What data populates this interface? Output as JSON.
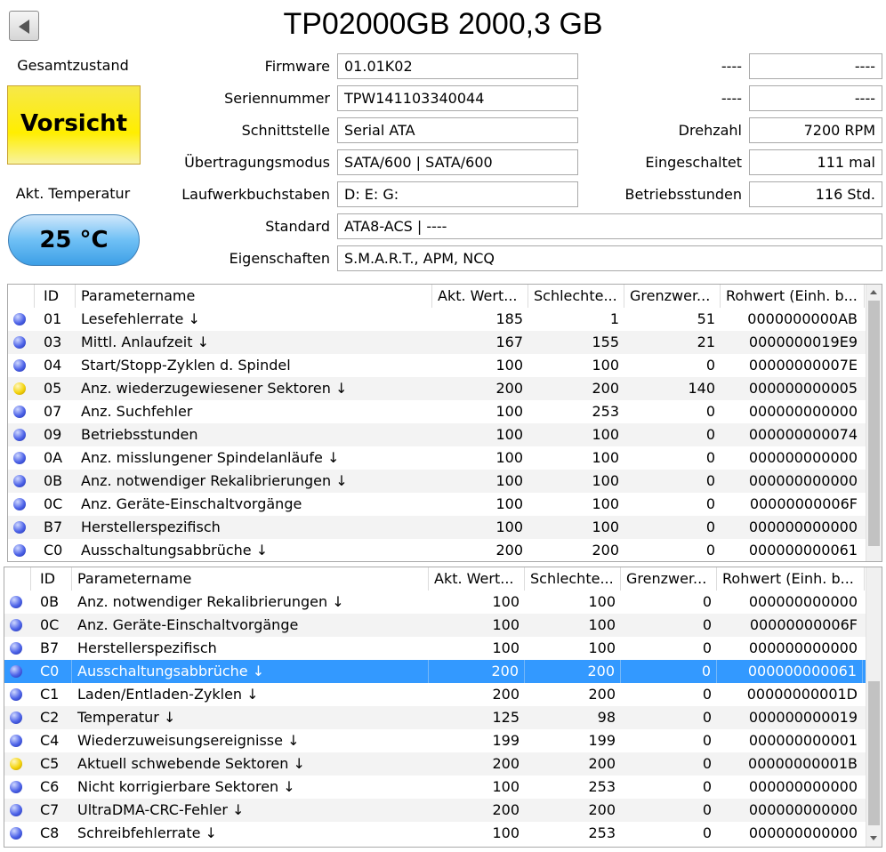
{
  "title": "TP02000GB 2000,3 GB",
  "icons": {
    "back": "back-arrow-icon",
    "status_good": "blue-status-dot-icon",
    "status_caution": "yellow-status-dot-icon"
  },
  "colors": {
    "caution": "#ffee00",
    "temperature": "#4aa8ee",
    "selection": "#3399ff"
  },
  "health": {
    "label": "Gesamtzustand",
    "value": "Vorsicht"
  },
  "temperature": {
    "label": "Akt. Temperatur",
    "value": "25 °C"
  },
  "info": {
    "firmware": {
      "label": "Firmware",
      "value": "01.01K02"
    },
    "serial": {
      "label": "Seriennummer",
      "value": "TPW141103340044"
    },
    "interface": {
      "label": "Schnittstelle",
      "value": "Serial ATA"
    },
    "transfer": {
      "label": "Übertragungsmodus",
      "value": "SATA/600 | SATA/600"
    },
    "drive_letters": {
      "label": "Laufwerkbuchstaben",
      "value": "D: E: G:"
    },
    "standard": {
      "label": "Standard",
      "value": "ATA8-ACS | ----"
    },
    "features": {
      "label": "Eigenschaften",
      "value": "S.M.A.R.T., APM, NCQ"
    }
  },
  "right_info": {
    "r1": {
      "label": "----",
      "value": "----"
    },
    "r2": {
      "label": "----",
      "value": "----"
    },
    "rpm": {
      "label": "Drehzahl",
      "value": "7200 RPM"
    },
    "power_count": {
      "label": "Eingeschaltet",
      "value": "111 mal"
    },
    "power_hours": {
      "label": "Betriebsstunden",
      "value": "116 Std."
    }
  },
  "columns": [
    "ID",
    "Parametername",
    "Akt. Wert...",
    "Schlechte...",
    "Grenzwer...",
    "Rohwert (Einh. b..."
  ],
  "table1_rows": [
    {
      "status": "blue",
      "id": "01",
      "name": "Lesefehlerrate ↓",
      "cur": "185",
      "worst": "1",
      "thr": "51",
      "raw": "0000000000AB"
    },
    {
      "status": "blue",
      "id": "03",
      "name": "Mittl. Anlaufzeit ↓",
      "cur": "167",
      "worst": "155",
      "thr": "21",
      "raw": "0000000019E9"
    },
    {
      "status": "blue",
      "id": "04",
      "name": "Start/Stopp-Zyklen d. Spindel",
      "cur": "100",
      "worst": "100",
      "thr": "0",
      "raw": "00000000007E"
    },
    {
      "status": "yellow",
      "id": "05",
      "name": "Anz. wiederzugewiesener Sektoren ↓",
      "cur": "200",
      "worst": "200",
      "thr": "140",
      "raw": "000000000005"
    },
    {
      "status": "blue",
      "id": "07",
      "name": "Anz. Suchfehler",
      "cur": "100",
      "worst": "253",
      "thr": "0",
      "raw": "000000000000"
    },
    {
      "status": "blue",
      "id": "09",
      "name": "Betriebsstunden",
      "cur": "100",
      "worst": "100",
      "thr": "0",
      "raw": "000000000074"
    },
    {
      "status": "blue",
      "id": "0A",
      "name": "Anz. misslungener Spindelanläufe ↓",
      "cur": "100",
      "worst": "100",
      "thr": "0",
      "raw": "000000000000"
    },
    {
      "status": "blue",
      "id": "0B",
      "name": "Anz. notwendiger Rekalibrierungen ↓",
      "cur": "100",
      "worst": "100",
      "thr": "0",
      "raw": "000000000000"
    },
    {
      "status": "blue",
      "id": "0C",
      "name": "Anz. Geräte-Einschaltvorgänge",
      "cur": "100",
      "worst": "100",
      "thr": "0",
      "raw": "00000000006F"
    },
    {
      "status": "blue",
      "id": "B7",
      "name": "Herstellerspezifisch",
      "cur": "100",
      "worst": "100",
      "thr": "0",
      "raw": "000000000000"
    },
    {
      "status": "blue",
      "id": "C0",
      "name": "Ausschaltungsabbrüche ↓",
      "cur": "200",
      "worst": "200",
      "thr": "0",
      "raw": "000000000061"
    }
  ],
  "table2_rows": [
    {
      "status": "blue",
      "id": "0B",
      "name": "Anz. notwendiger Rekalibrierungen ↓",
      "cur": "100",
      "worst": "100",
      "thr": "0",
      "raw": "000000000000"
    },
    {
      "status": "blue",
      "id": "0C",
      "name": "Anz. Geräte-Einschaltvorgänge",
      "cur": "100",
      "worst": "100",
      "thr": "0",
      "raw": "00000000006F"
    },
    {
      "status": "blue",
      "id": "B7",
      "name": "Herstellerspezifisch",
      "cur": "100",
      "worst": "100",
      "thr": "0",
      "raw": "000000000000"
    },
    {
      "status": "blue",
      "id": "C0",
      "name": "Ausschaltungsabbrüche ↓",
      "cur": "200",
      "worst": "200",
      "thr": "0",
      "raw": "000000000061",
      "selected": true
    },
    {
      "status": "blue",
      "id": "C1",
      "name": "Laden/Entladen-Zyklen ↓",
      "cur": "200",
      "worst": "200",
      "thr": "0",
      "raw": "00000000001D"
    },
    {
      "status": "blue",
      "id": "C2",
      "name": "Temperatur ↓",
      "cur": "125",
      "worst": "98",
      "thr": "0",
      "raw": "000000000019"
    },
    {
      "status": "blue",
      "id": "C4",
      "name": "Wiederzuweisungsereignisse ↓",
      "cur": "199",
      "worst": "199",
      "thr": "0",
      "raw": "000000000001"
    },
    {
      "status": "yellow",
      "id": "C5",
      "name": "Aktuell schwebende Sektoren ↓",
      "cur": "200",
      "worst": "200",
      "thr": "0",
      "raw": "00000000001B"
    },
    {
      "status": "blue",
      "id": "C6",
      "name": "Nicht korrigierbare Sektoren ↓",
      "cur": "100",
      "worst": "253",
      "thr": "0",
      "raw": "000000000000"
    },
    {
      "status": "blue",
      "id": "C7",
      "name": "UltraDMA-CRC-Fehler ↓",
      "cur": "200",
      "worst": "200",
      "thr": "0",
      "raw": "000000000000"
    },
    {
      "status": "blue",
      "id": "C8",
      "name": "Schreibfehlerrate ↓",
      "cur": "100",
      "worst": "253",
      "thr": "0",
      "raw": "000000000000"
    }
  ]
}
